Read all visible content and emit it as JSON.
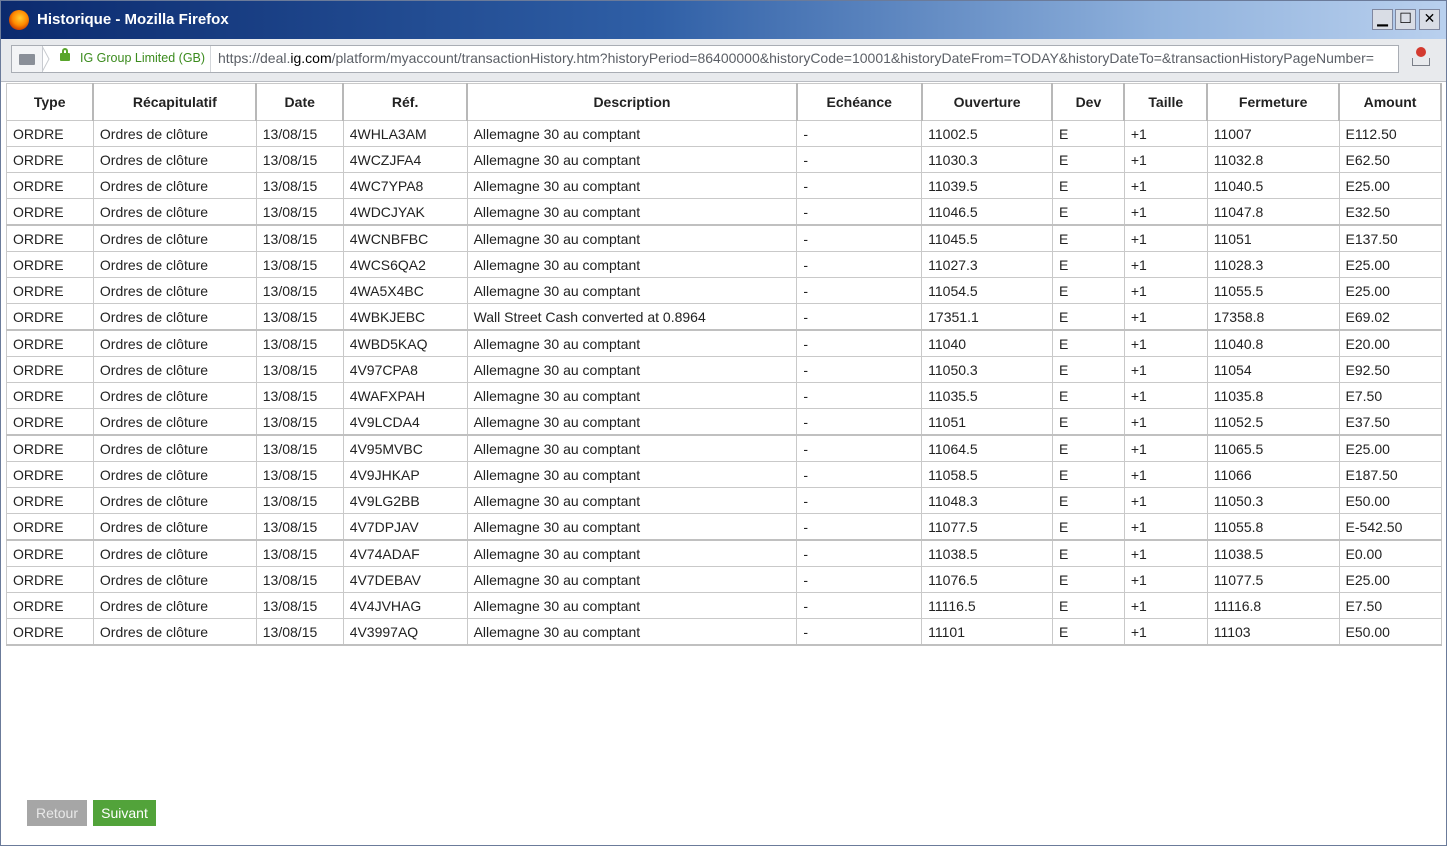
{
  "window": {
    "title": "Historique - Mozilla Firefox",
    "min_glyph": "▁",
    "max_glyph": "☐",
    "close_glyph": "✕"
  },
  "navbar": {
    "identity_org": "IG Group Limited (GB)",
    "url_prefix": "https://deal.",
    "url_host": "ig.com",
    "url_rest": "/platform/myaccount/transactionHistory.htm?historyPeriod=86400000&historyCode=10001&historyDateFrom=TODAY&historyDateTo=&transactionHistoryPageNumber="
  },
  "table": {
    "columns": [
      "Type",
      "Récapitulatif",
      "Date",
      "Réf.",
      "Description",
      "Echéance",
      "Ouverture",
      "Dev",
      "Taille",
      "Fermeture",
      "Amount"
    ],
    "rows": [
      [
        "ORDRE",
        "Ordres de clôture",
        "13/08/15",
        "4WHLA3AM",
        "Allemagne 30 au comptant",
        "-",
        "11002.5",
        "E",
        "+1",
        "11007",
        "E112.50"
      ],
      [
        "ORDRE",
        "Ordres de clôture",
        "13/08/15",
        "4WCZJFA4",
        "Allemagne 30 au comptant",
        "-",
        "11030.3",
        "E",
        "+1",
        "11032.8",
        "E62.50"
      ],
      [
        "ORDRE",
        "Ordres de clôture",
        "13/08/15",
        "4WC7YPA8",
        "Allemagne 30 au comptant",
        "-",
        "11039.5",
        "E",
        "+1",
        "11040.5",
        "E25.00"
      ],
      [
        "ORDRE",
        "Ordres de clôture",
        "13/08/15",
        "4WDCJYAK",
        "Allemagne 30 au comptant",
        "-",
        "11046.5",
        "E",
        "+1",
        "11047.8",
        "E32.50"
      ],
      [
        "ORDRE",
        "Ordres de clôture",
        "13/08/15",
        "4WCNBFBC",
        "Allemagne 30 au comptant",
        "-",
        "11045.5",
        "E",
        "+1",
        "11051",
        "E137.50"
      ],
      [
        "ORDRE",
        "Ordres de clôture",
        "13/08/15",
        "4WCS6QA2",
        "Allemagne 30 au comptant",
        "-",
        "11027.3",
        "E",
        "+1",
        "11028.3",
        "E25.00"
      ],
      [
        "ORDRE",
        "Ordres de clôture",
        "13/08/15",
        "4WA5X4BC",
        "Allemagne 30 au comptant",
        "-",
        "11054.5",
        "E",
        "+1",
        "11055.5",
        "E25.00"
      ],
      [
        "ORDRE",
        "Ordres de clôture",
        "13/08/15",
        "4WBKJEBC",
        "Wall Street Cash converted at 0.8964",
        "-",
        "17351.1",
        "E",
        "+1",
        "17358.8",
        "E69.02"
      ],
      [
        "ORDRE",
        "Ordres de clôture",
        "13/08/15",
        "4WBD5KAQ",
        "Allemagne 30 au comptant",
        "-",
        "11040",
        "E",
        "+1",
        "11040.8",
        "E20.00"
      ],
      [
        "ORDRE",
        "Ordres de clôture",
        "13/08/15",
        "4V97CPA8",
        "Allemagne 30 au comptant",
        "-",
        "11050.3",
        "E",
        "+1",
        "11054",
        "E92.50"
      ],
      [
        "ORDRE",
        "Ordres de clôture",
        "13/08/15",
        "4WAFXPAH",
        "Allemagne 30 au comptant",
        "-",
        "11035.5",
        "E",
        "+1",
        "11035.8",
        "E7.50"
      ],
      [
        "ORDRE",
        "Ordres de clôture",
        "13/08/15",
        "4V9LCDA4",
        "Allemagne 30 au comptant",
        "-",
        "11051",
        "E",
        "+1",
        "11052.5",
        "E37.50"
      ],
      [
        "ORDRE",
        "Ordres de clôture",
        "13/08/15",
        "4V95MVBC",
        "Allemagne 30 au comptant",
        "-",
        "11064.5",
        "E",
        "+1",
        "11065.5",
        "E25.00"
      ],
      [
        "ORDRE",
        "Ordres de clôture",
        "13/08/15",
        "4V9JHKAP",
        "Allemagne 30 au comptant",
        "-",
        "11058.5",
        "E",
        "+1",
        "11066",
        "E187.50"
      ],
      [
        "ORDRE",
        "Ordres de clôture",
        "13/08/15",
        "4V9LG2BB",
        "Allemagne 30 au comptant",
        "-",
        "11048.3",
        "E",
        "+1",
        "11050.3",
        "E50.00"
      ],
      [
        "ORDRE",
        "Ordres de clôture",
        "13/08/15",
        "4V7DPJAV",
        "Allemagne 30 au comptant",
        "-",
        "11077.5",
        "E",
        "+1",
        "11055.8",
        "E-542.50"
      ],
      [
        "ORDRE",
        "Ordres de clôture",
        "13/08/15",
        "4V74ADAF",
        "Allemagne 30 au comptant",
        "-",
        "11038.5",
        "E",
        "+1",
        "11038.5",
        "E0.00"
      ],
      [
        "ORDRE",
        "Ordres de clôture",
        "13/08/15",
        "4V7DEBAV",
        "Allemagne 30 au comptant",
        "-",
        "11076.5",
        "E",
        "+1",
        "11077.5",
        "E25.00"
      ],
      [
        "ORDRE",
        "Ordres de clôture",
        "13/08/15",
        "4V4JVHAG",
        "Allemagne 30 au comptant",
        "-",
        "11116.5",
        "E",
        "+1",
        "11116.8",
        "E7.50"
      ],
      [
        "ORDRE",
        "Ordres de clôture",
        "13/08/15",
        "4V3997AQ",
        "Allemagne 30 au comptant",
        "-",
        "11101",
        "E",
        "+1",
        "11103",
        "E50.00"
      ]
    ]
  },
  "pagination": {
    "prev_label": "Retour",
    "next_label": "Suivant"
  },
  "icons": {
    "app": "firefox-icon",
    "identity": "page-identity-icon",
    "lock": "lock-icon",
    "notification": "notification-icon"
  },
  "colors": {
    "titlebar_start": "#0b2a6e",
    "titlebar_end": "#b9d0ee",
    "secure_green": "#3b8b1d",
    "next_button": "#52a33a",
    "prev_button": "#a6a6a6"
  }
}
